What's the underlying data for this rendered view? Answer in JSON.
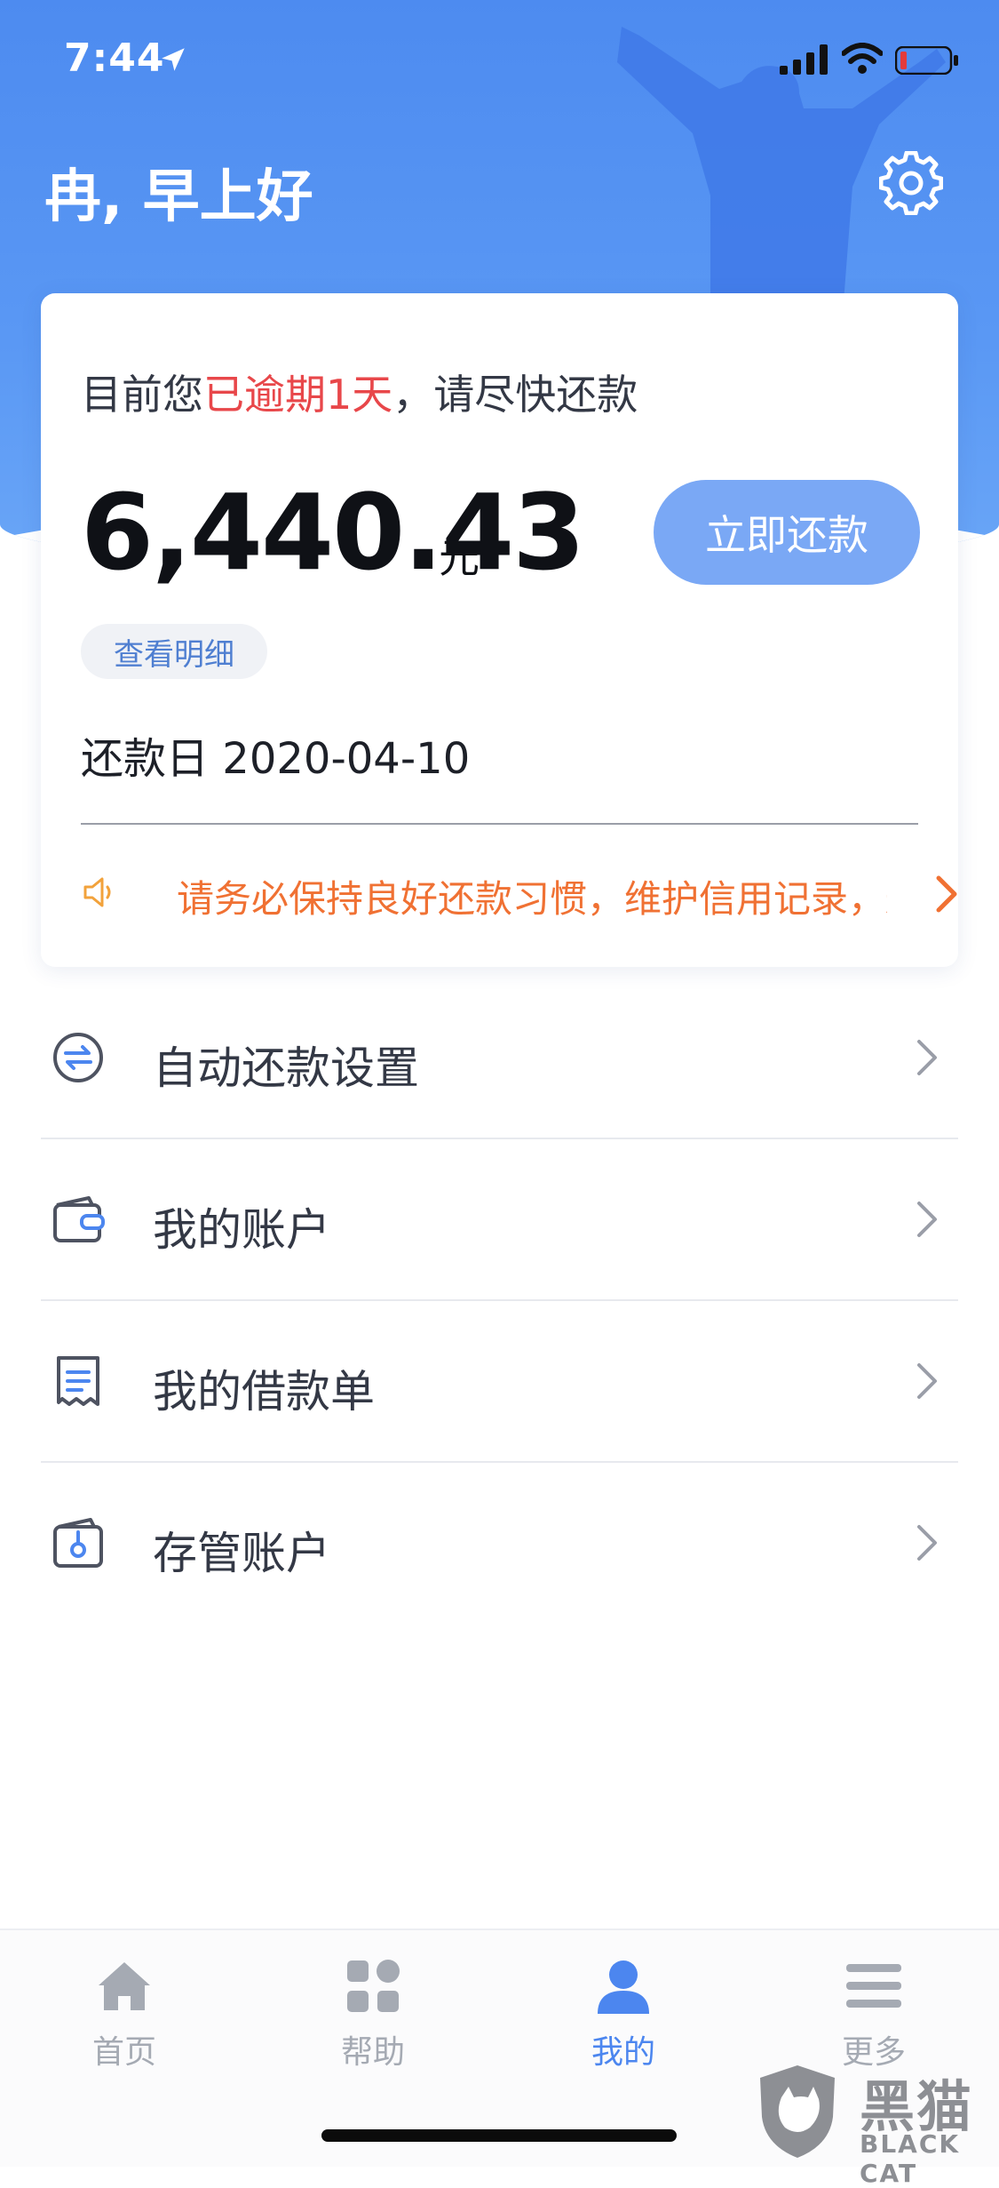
{
  "status_bar": {
    "time": "7:44"
  },
  "header": {
    "greeting": "冉, 早上好"
  },
  "loan_card": {
    "overdue_prefix": "目前您",
    "overdue_highlight": "已逾期1天",
    "overdue_suffix": "，请尽快还款",
    "amount": "6,440.43",
    "amount_unit": "元",
    "repay_button": "立即还款",
    "detail_link": "查看明细",
    "due_date_label": "还款日",
    "due_date": "2020-04-10",
    "notice": "请务必保持良好还款习惯，维护信用记录，避"
  },
  "menu": {
    "items": [
      {
        "label": "自动还款设置",
        "icon": "auto-repay-icon"
      },
      {
        "label": "我的账户",
        "icon": "wallet-icon"
      },
      {
        "label": "我的借款单",
        "icon": "receipt-icon"
      },
      {
        "label": "存管账户",
        "icon": "custody-account-icon"
      }
    ]
  },
  "tabbar": {
    "tabs": [
      {
        "label": "首页",
        "icon": "home-icon",
        "active": false
      },
      {
        "label": "帮助",
        "icon": "grid-icon",
        "active": false
      },
      {
        "label": "我的",
        "icon": "user-icon",
        "active": true
      },
      {
        "label": "更多",
        "icon": "menu-icon",
        "active": false
      }
    ]
  },
  "watermark": {
    "cn": "黑猫",
    "en": "BLACK CAT"
  },
  "colors": {
    "header_blue": "#5a98f4",
    "overdue_red": "#e8474a",
    "repay_button": "#7aa8f5",
    "notice_orange": "#f07133",
    "tab_active": "#4c86ef",
    "tab_inactive": "#a5aab3"
  }
}
